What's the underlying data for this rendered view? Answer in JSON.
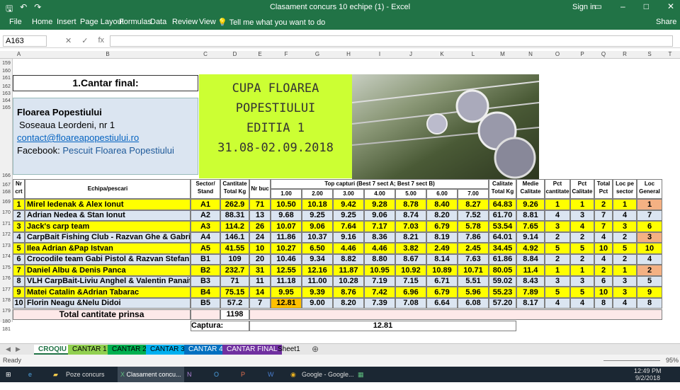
{
  "window": {
    "title": "Clasament concurs 10 echipe (1) - Excel",
    "signin": "Sign in"
  },
  "ribbon": {
    "tabs": [
      "File",
      "Home",
      "Insert",
      "Page Layout",
      "Formulas",
      "Data",
      "Review",
      "View"
    ],
    "tell_me": "Tell me what you want to do",
    "share": "Share"
  },
  "formula_bar": {
    "name_box": "A163",
    "fx": "fx",
    "value": ""
  },
  "columns": [
    "A",
    "B",
    "C",
    "D",
    "E",
    "F",
    "G",
    "H",
    "I",
    "J",
    "K",
    "L",
    "M",
    "N",
    "O",
    "P",
    "Q",
    "R",
    "S",
    "T"
  ],
  "rows": [
    "159",
    "160",
    "161",
    "162",
    "163",
    "164",
    "165",
    "166",
    "167",
    "168",
    "169",
    "170",
    "171",
    "172",
    "173",
    "174",
    "175",
    "176",
    "177",
    "178",
    "179",
    "180",
    "181"
  ],
  "sheet": {
    "title": "1.Cantar final:",
    "contact": {
      "name": "Floarea Popestiului",
      "address": "Soseaua Leordeni, nr 1",
      "email": "contact@floareapopestiului.ro",
      "facebook_label": "Facebook:",
      "facebook_value": "Pescuit Floarea Popestiului"
    },
    "cupa": {
      "line1": "CUPA  FLOAREA",
      "line2": "POPESTIULUI",
      "line3": "EDITIA 1",
      "line4": "31.08-02.09.2018"
    },
    "headers": {
      "nr": "Nr",
      "crt": "crt",
      "echipa": "Echipa/pescari",
      "sector1": "Sector/",
      "sector2": "Stand",
      "cant1": "Cantitate",
      "cant2": "Total Kg",
      "nrbuc": "Nr buc",
      "top": "Top capturi (Best 7 sect A; Best 7 sect B)",
      "cal1": "Calitate",
      "cal2": "Total Kg",
      "med1": "Medie",
      "med2": "Calitate",
      "pc1": "Pct",
      "pc2": "cantitate",
      "pq1": "Pct",
      "pq2": "Calitate",
      "tp1": "Total",
      "tp2": "Pct",
      "ls1": "Loc pe",
      "ls2": "sector",
      "lg1": "Loc",
      "lg2": "General",
      "top_cols": [
        "1.00",
        "2.00",
        "3.00",
        "4.00",
        "5.00",
        "6.00",
        "7.00"
      ]
    },
    "teams": [
      {
        "nr": "1",
        "team": "Mirel Iedenak & Alex Ionut",
        "stand": "A1",
        "kg": "262.9",
        "buc": "71",
        "top": [
          "10.50",
          "10.18",
          "9.42",
          "9.28",
          "8.78",
          "8.40",
          "8.27"
        ],
        "cal": "64.83",
        "med": "9.26",
        "pc": "1",
        "pq": "1",
        "tp": "2",
        "ls": "1",
        "lg": "1",
        "yellow": true,
        "lg_orange": true
      },
      {
        "nr": "2",
        "team": "Adrian Nedea & Stan Ionut",
        "stand": "A2",
        "kg": "88.31",
        "buc": "13",
        "top": [
          "9.68",
          "9.25",
          "9.25",
          "9.06",
          "8.74",
          "8.20",
          "7.52"
        ],
        "cal": "61.70",
        "med": "8.81",
        "pc": "4",
        "pq": "3",
        "tp": "7",
        "ls": "4",
        "lg": "7",
        "yellow": false,
        "lg_orange": false
      },
      {
        "nr": "3",
        "team": "Jack's carp team",
        "stand": "A3",
        "kg": "114.2",
        "buc": "26",
        "top": [
          "10.07",
          "9.06",
          "7.64",
          "7.17",
          "7.03",
          "6.79",
          "5.78"
        ],
        "cal": "53.54",
        "med": "7.65",
        "pc": "3",
        "pq": "4",
        "tp": "7",
        "ls": "3",
        "lg": "6",
        "yellow": true,
        "lg_orange": false
      },
      {
        "nr": "4",
        "team": "CarpBait Fishing Club - Razvan Ghe & Gabriel C-tin",
        "stand": "A4",
        "kg": "146.1",
        "buc": "24",
        "top": [
          "11.86",
          "10.37",
          "9.16",
          "8.36",
          "8.21",
          "8.19",
          "7.86"
        ],
        "cal": "64.01",
        "med": "9.14",
        "pc": "2",
        "pq": "2",
        "tp": "4",
        "ls": "2",
        "lg": "3",
        "yellow": false,
        "lg_orange": true
      },
      {
        "nr": "5",
        "team": "Ilea Adrian &Pap Istvan",
        "stand": "A5",
        "kg": "41.55",
        "buc": "10",
        "top": [
          "10.27",
          "6.50",
          "4.46",
          "4.46",
          "3.82",
          "2.49",
          "2.45"
        ],
        "cal": "34.45",
        "med": "4.92",
        "pc": "5",
        "pq": "5",
        "tp": "10",
        "ls": "5",
        "lg": "10",
        "yellow": true,
        "lg_orange": false
      },
      {
        "nr": "6",
        "team": "Crocodile team Gabi Pistol & Razvan Stefan",
        "stand": "B1",
        "kg": "109",
        "buc": "20",
        "top": [
          "10.46",
          "9.34",
          "8.82",
          "8.80",
          "8.67",
          "8.14",
          "7.63"
        ],
        "cal": "61.86",
        "med": "8.84",
        "pc": "2",
        "pq": "2",
        "tp": "4",
        "ls": "2",
        "lg": "4",
        "yellow": false,
        "lg_orange": false
      },
      {
        "nr": "7",
        "team": "Daniel Albu & Denis Panca",
        "stand": "B2",
        "kg": "232.7",
        "buc": "31",
        "top": [
          "12.55",
          "12.16",
          "11.87",
          "10.95",
          "10.92",
          "10.89",
          "10.71"
        ],
        "cal": "80.05",
        "med": "11.4",
        "pc": "1",
        "pq": "1",
        "tp": "2",
        "ls": "1",
        "lg": "2",
        "yellow": true,
        "lg_orange": true
      },
      {
        "nr": "8",
        "team": "VLH CarpBait-Liviu Anghel & Valentin Panait",
        "stand": "B3",
        "kg": "71",
        "buc": "11",
        "top": [
          "11.18",
          "11.00",
          "10.28",
          "7.19",
          "7.15",
          "6.71",
          "5.51"
        ],
        "cal": "59.02",
        "med": "8.43",
        "pc": "3",
        "pq": "3",
        "tp": "6",
        "ls": "3",
        "lg": "5",
        "yellow": false,
        "lg_orange": false
      },
      {
        "nr": "9",
        "team": "Matei Catalin &Adrian Tabarac",
        "stand": "B4",
        "kg": "75.15",
        "buc": "14",
        "top": [
          "9.95",
          "9.39",
          "8.76",
          "7.42",
          "6.96",
          "6.79",
          "5.96"
        ],
        "cal": "55.23",
        "med": "7.89",
        "pc": "5",
        "pq": "5",
        "tp": "10",
        "ls": "3",
        "lg": "9",
        "yellow": true,
        "lg_orange": false
      },
      {
        "nr": "10",
        "team": "Florin Neagu &Nelu Didoi",
        "stand": "B5",
        "kg": "57.2",
        "buc": "7",
        "top": [
          "12.81",
          "9.00",
          "8.20",
          "7.39",
          "7.08",
          "6.64",
          "6.08"
        ],
        "cal": "57.20",
        "med": "8.17",
        "pc": "4",
        "pq": "4",
        "tp": "8",
        "ls": "4",
        "lg": "8",
        "yellow": false,
        "lg_orange": false
      }
    ],
    "total_label": "Total cantitate prinsa",
    "total_value": "1198",
    "captura_label": "Captura:",
    "captura_value": "12.81"
  },
  "sheet_tabs": [
    "CROQIU",
    "CANTAR 1",
    "CANTAR 2",
    "CANTAR 3",
    "CANTAR 4",
    "CANTAR FINAL",
    "Sheet1"
  ],
  "status": {
    "ready": "Ready",
    "zoom": "95%"
  },
  "taskbar": {
    "items": [
      "Poze concurs",
      "Clasament concu...",
      "Google - Google..."
    ],
    "time": "12:49 PM",
    "date": "9/2/2018"
  },
  "colors": {
    "excel_green": "#217346",
    "yellow": "#ffff00",
    "blue_row": "#dbe5f1",
    "orange": "#f4b183",
    "lime": "#ccff33"
  }
}
